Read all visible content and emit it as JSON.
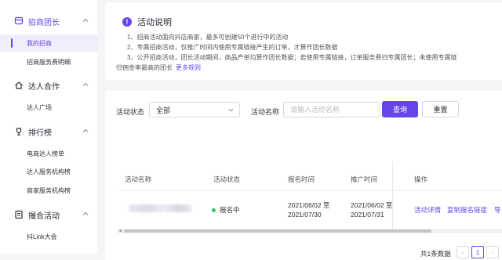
{
  "sidebar": {
    "groups": [
      {
        "title": "招商团长",
        "items": [
          "我的招商",
          "招商服务费明细"
        ]
      },
      {
        "title": "达人合作",
        "items": [
          "达人广场"
        ]
      },
      {
        "title": "排行榜",
        "items": [
          "电商达人榜单",
          "达人服务机构榜",
          "商家服务机构榜"
        ]
      },
      {
        "title": "撮合活动",
        "items": [
          "抖Link大会"
        ]
      }
    ]
  },
  "notice": {
    "title": "活动说明",
    "lines": [
      "1、招商活动面向抖店商家，最多可创建50个进行中的活动",
      "2、专属招商活动，仅推广时间内使用专属链接产生的订单，才算作团长数据",
      "3、公开招商活动，团长活动期间，商品产单均算作团长数据；若使用专属链接，订单服务费归专属团长；未使用专属链",
      "归佣金率最高的团长"
    ],
    "more_link": "更多规则"
  },
  "filters": {
    "status_label": "活动状态",
    "status_value": "全部",
    "name_label": "活动名称",
    "name_placeholder": "请输入活动名称",
    "search_button": "查询",
    "reset_button": "重置"
  },
  "table": {
    "headers": [
      "活动名称",
      "活动状态",
      "报名时间",
      "推广时间",
      "操作"
    ],
    "rows": [
      {
        "status": "报名中",
        "signup_start": "2021/06/02 至",
        "signup_end": "2021/07/30",
        "promo_start": "2021/06/02 至",
        "promo_end": "2021/07/31",
        "actions": [
          "活动详情",
          "复制报名链接",
          "导"
        ]
      }
    ]
  },
  "pagination": {
    "total_text": "共1条数据",
    "current_page": "1",
    "prev": "‹",
    "next": "›"
  },
  "colors": {
    "accent": "#6745e8",
    "status_green": "#2ebf5e"
  }
}
